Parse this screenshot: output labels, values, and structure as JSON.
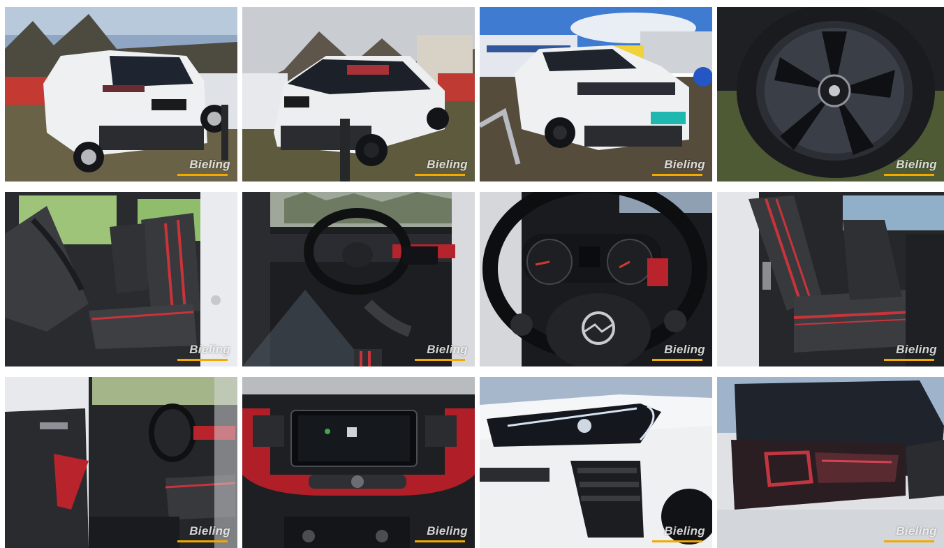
{
  "gallery": {
    "watermark": "Bieling",
    "accent_color": "#f2a900",
    "photos": [
      {
        "subject": "rear-three-quarter-left"
      },
      {
        "subject": "rear-three-quarter-right"
      },
      {
        "subject": "front-three-quarter"
      },
      {
        "subject": "alloy-wheel"
      },
      {
        "subject": "driver-seat"
      },
      {
        "subject": "dashboard-cockpit"
      },
      {
        "subject": "steering-wheel-instruments"
      },
      {
        "subject": "rear-seats"
      },
      {
        "subject": "door-interior"
      },
      {
        "subject": "infotainment-screen"
      },
      {
        "subject": "headlight"
      },
      {
        "subject": "tail-light"
      }
    ]
  }
}
